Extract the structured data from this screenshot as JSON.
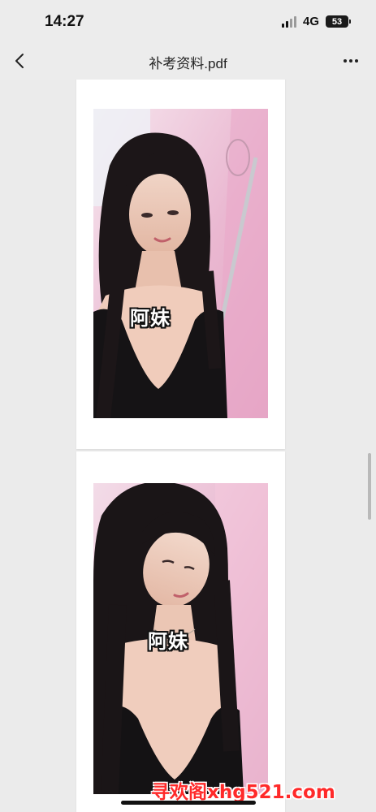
{
  "status_bar": {
    "time": "14:27",
    "network": "4G",
    "battery": "53"
  },
  "nav": {
    "title": "补考资料.pdf"
  },
  "pages": [
    {
      "caption": "阿妹"
    },
    {
      "caption": "阿妹"
    }
  ],
  "watermark": "寻欢阁xhg521.com",
  "colors": {
    "background": "#ebebeb",
    "page": "#ffffff",
    "watermark": "#ff2a2a"
  }
}
